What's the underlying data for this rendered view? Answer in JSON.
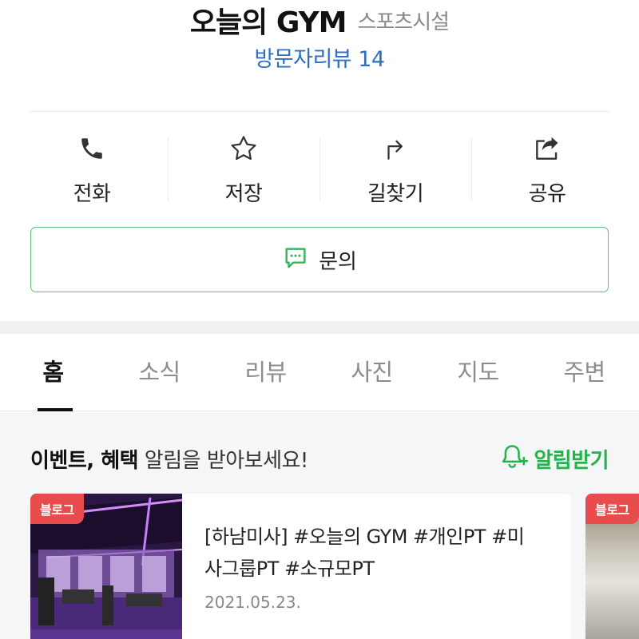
{
  "header": {
    "place_name": "오늘의 GYM",
    "category": "스포츠시설",
    "review_link": "방문자리뷰 14"
  },
  "actions": [
    {
      "label": "전화",
      "icon": "phone-icon"
    },
    {
      "label": "저장",
      "icon": "star-icon"
    },
    {
      "label": "길찾기",
      "icon": "directions-icon"
    },
    {
      "label": "공유",
      "icon": "share-icon"
    }
  ],
  "inquiry": {
    "label": "문의",
    "icon": "chat-icon"
  },
  "tabs": [
    {
      "label": "홈",
      "active": true
    },
    {
      "label": "소식"
    },
    {
      "label": "리뷰"
    },
    {
      "label": "사진"
    },
    {
      "label": "지도"
    },
    {
      "label": "주변"
    }
  ],
  "events": {
    "title_bold": "이벤트, 혜택",
    "title_rest": " 알림을 받아보세요!",
    "alarm_label": "알림받기"
  },
  "cards": [
    {
      "badge": "블로그",
      "text": "[하남미사] #오늘의 GYM #개인PT #미사그룹PT #소규모PT",
      "date": "2021.05.23."
    },
    {
      "badge": "블로그"
    }
  ],
  "colors": {
    "accent_green": "#24b24b",
    "link_blue": "#2f6fc3",
    "badge_red": "#e84b4b"
  }
}
